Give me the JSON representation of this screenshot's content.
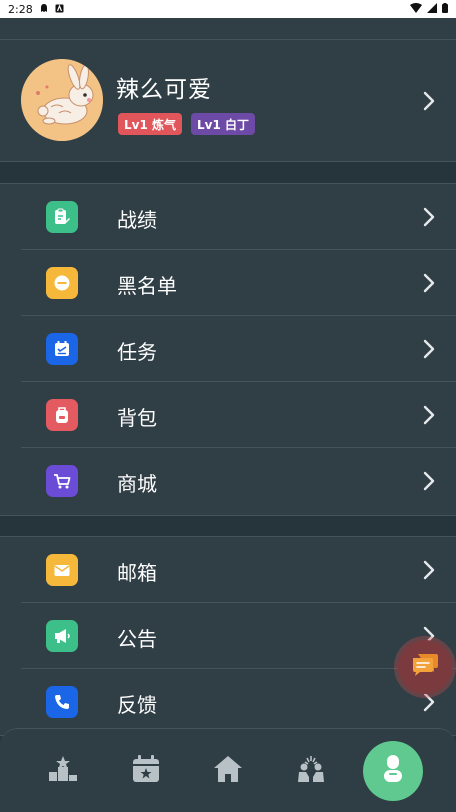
{
  "status_bar": {
    "time": "2:28"
  },
  "profile": {
    "username": "辣么可爱",
    "badges": [
      {
        "text": "Lv1 炼气",
        "color": "#e0565b"
      },
      {
        "text": "Lv1 白丁",
        "color": "#6c4aa5"
      }
    ]
  },
  "menu_group_1": [
    {
      "label": "战绩",
      "icon": "record-edit-icon",
      "color": "#3dbf8a"
    },
    {
      "label": "黑名单",
      "icon": "block-icon",
      "color": "#f5b83a"
    },
    {
      "label": "任务",
      "icon": "task-calendar-icon",
      "color": "#1a66e6"
    },
    {
      "label": "背包",
      "icon": "backpack-icon",
      "color": "#e35b60"
    },
    {
      "label": "商城",
      "icon": "shopping-cart-icon",
      "color": "#6a4cd6"
    }
  ],
  "menu_group_2": [
    {
      "label": "邮箱",
      "icon": "mail-icon",
      "color": "#f5b83a"
    },
    {
      "label": "公告",
      "icon": "megaphone-icon",
      "color": "#3dbf8a"
    },
    {
      "label": "反馈",
      "icon": "phone-icon",
      "color": "#1a66e6"
    }
  ],
  "tabbar": {
    "tabs": [
      "ranking-icon",
      "calendar-star-icon",
      "home-icon",
      "celebrate-icon",
      "profile-icon"
    ],
    "active_index": 4,
    "active_color": "#5fc98f"
  },
  "colors": {
    "background": "#26343c",
    "panel": "#303e46",
    "divider": "#45545c"
  }
}
